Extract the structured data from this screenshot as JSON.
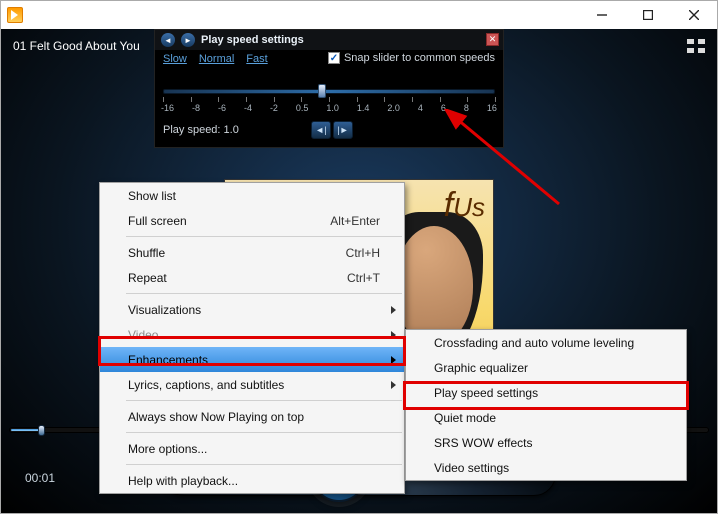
{
  "titlebar": {
    "title": ""
  },
  "player": {
    "track_title": "01 Felt Good About You",
    "timecode": "00:01"
  },
  "album": {
    "text1": "f",
    "text2": "Us"
  },
  "speed_panel": {
    "title": "Play speed settings",
    "links": {
      "slow": "Slow",
      "normal": "Normal",
      "fast": "Fast"
    },
    "snap_label": "Snap slider to common speeds",
    "snap_checked": true,
    "ticks": [
      "-16",
      "-8",
      "-6",
      "-4",
      "-2",
      "0.5",
      "1.0",
      "1.4",
      "2.0",
      "4",
      "6",
      "8",
      "16"
    ],
    "readout_prefix": "Play speed:",
    "readout_value": "1.0",
    "thumb_pct": 48
  },
  "context_menu": {
    "items": [
      {
        "label": "Show list",
        "shortcut": ""
      },
      {
        "label": "Full screen",
        "shortcut": "Alt+Enter"
      },
      {
        "sep": true
      },
      {
        "label": "Shuffle",
        "shortcut": "Ctrl+H"
      },
      {
        "label": "Repeat",
        "shortcut": "Ctrl+T"
      },
      {
        "sep": true
      },
      {
        "label": "Visualizations",
        "submenu": true
      },
      {
        "label": "Video",
        "submenu": true,
        "disabled": true
      },
      {
        "label": "Enhancements",
        "submenu": true,
        "selected": true
      },
      {
        "label": "Lyrics, captions, and subtitles",
        "submenu": true
      },
      {
        "sep": true
      },
      {
        "label": "Always show Now Playing on top"
      },
      {
        "sep": true
      },
      {
        "label": "More options..."
      },
      {
        "sep": true
      },
      {
        "label": "Help with playback..."
      }
    ]
  },
  "sub_menu": {
    "items": [
      {
        "label": "Crossfading and auto volume leveling"
      },
      {
        "label": "Graphic equalizer"
      },
      {
        "label": "Play speed settings",
        "highlight": true
      },
      {
        "label": "Quiet mode"
      },
      {
        "label": "SRS WOW effects"
      },
      {
        "label": "Video settings"
      }
    ]
  }
}
